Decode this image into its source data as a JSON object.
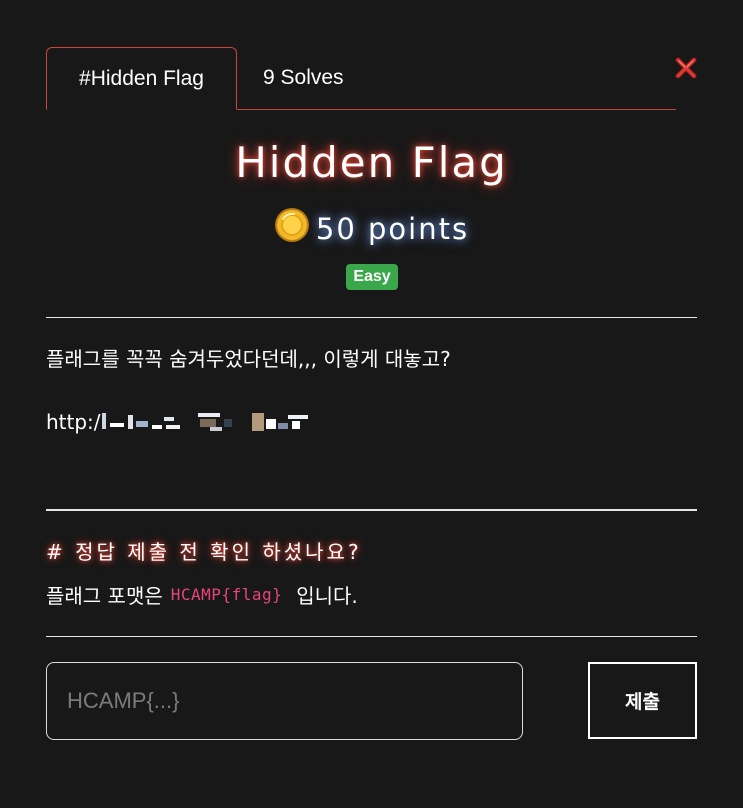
{
  "tabs": {
    "active_label": "#Hidden Flag",
    "solves_label": "9 Solves"
  },
  "challenge": {
    "title": "Hidden Flag",
    "points_label": "50 points",
    "difficulty": "Easy",
    "description": "플래그를 꼭꼭 숨겨두었다던데,,, 이렇게 대놓고?",
    "url_prefix": "http:/"
  },
  "notice": {
    "heading": "# 정답 제출 전 확인 하셨나요?",
    "format_prefix": "플래그 포맷은",
    "format_code": "HCAMP{flag}",
    "format_suffix": "입니다."
  },
  "submission": {
    "placeholder": "HCAMP{...}",
    "submit_label": "제출"
  },
  "colors": {
    "background": "#181818",
    "tab_border": "#c8453c",
    "easy_badge": "#3aa84a",
    "code_text": "#e8457a",
    "close_icon": "#e03a32"
  },
  "icons": {
    "close": "close-icon",
    "coin": "coin-icon"
  }
}
